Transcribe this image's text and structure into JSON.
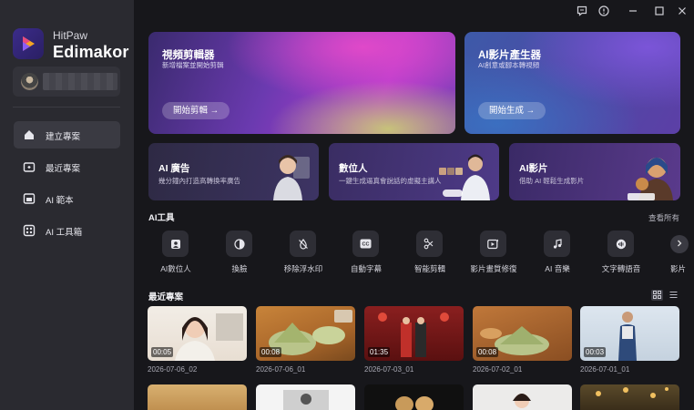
{
  "app": {
    "brand_line1": "HitPaw",
    "brand_line2": "Edimakor"
  },
  "sidebar": {
    "items": [
      {
        "label": "建立專案",
        "icon": "home-icon",
        "active": true
      },
      {
        "label": "最近專案",
        "icon": "recent-folder-icon",
        "active": false
      },
      {
        "label": "AI 範本",
        "icon": "template-icon",
        "active": false
      },
      {
        "label": "AI 工具箱",
        "icon": "toolbox-icon",
        "active": false
      }
    ]
  },
  "titlebar": {
    "icons": [
      "feedback-icon",
      "info-icon",
      "minimize-icon",
      "maximize-icon",
      "close-icon"
    ]
  },
  "hero": [
    {
      "title": "視頻剪輯器",
      "subtitle": "新增檔案並開始剪輯",
      "button": "開始剪輯 →"
    },
    {
      "title": "AI影片產生器",
      "subtitle": "AI創意或腳本轉視頻",
      "button": "開始生成 →"
    }
  ],
  "features": [
    {
      "title": "AI 廣告",
      "subtitle": "幾分鐘內打造高轉換率廣告"
    },
    {
      "title": "數位人",
      "subtitle": "一鍵生成逼真會說話的虛擬主講人"
    },
    {
      "title": "AI影片",
      "subtitle": "借助 AI 輕鬆生成影片"
    }
  ],
  "ai_tools": {
    "title": "AI工具",
    "see_all": "查看所有",
    "items": [
      {
        "label": "AI數位人",
        "icon": "avatar-box-icon"
      },
      {
        "label": "換臉",
        "icon": "face-swap-icon"
      },
      {
        "label": "移除浮水印",
        "icon": "erase-watermark-icon"
      },
      {
        "label": "自動字幕",
        "icon": "cc-subtitle-icon"
      },
      {
        "label": "智能剪輯",
        "icon": "scissors-ai-icon"
      },
      {
        "label": "影片畫質修復",
        "icon": "video-enhance-icon"
      },
      {
        "label": "AI 音樂",
        "icon": "music-note-icon"
      },
      {
        "label": "文字轉語音",
        "icon": "text-to-speech-icon"
      },
      {
        "label": "影片",
        "icon": "video-icon"
      }
    ]
  },
  "recent": {
    "title": "最近專案",
    "projects": [
      {
        "duration": "00:05",
        "date": "2026-07-06_02"
      },
      {
        "duration": "00:08",
        "date": "2026-07-06_01"
      },
      {
        "duration": "01:35",
        "date": "2026-07-03_01"
      },
      {
        "duration": "00:08",
        "date": "2026-07-02_01"
      },
      {
        "duration": "00:03",
        "date": "2026-07-01_01"
      }
    ]
  },
  "colors": {
    "background": "#17171b",
    "sidebar": "#2a2a30",
    "accent": "#6b3ab0"
  }
}
